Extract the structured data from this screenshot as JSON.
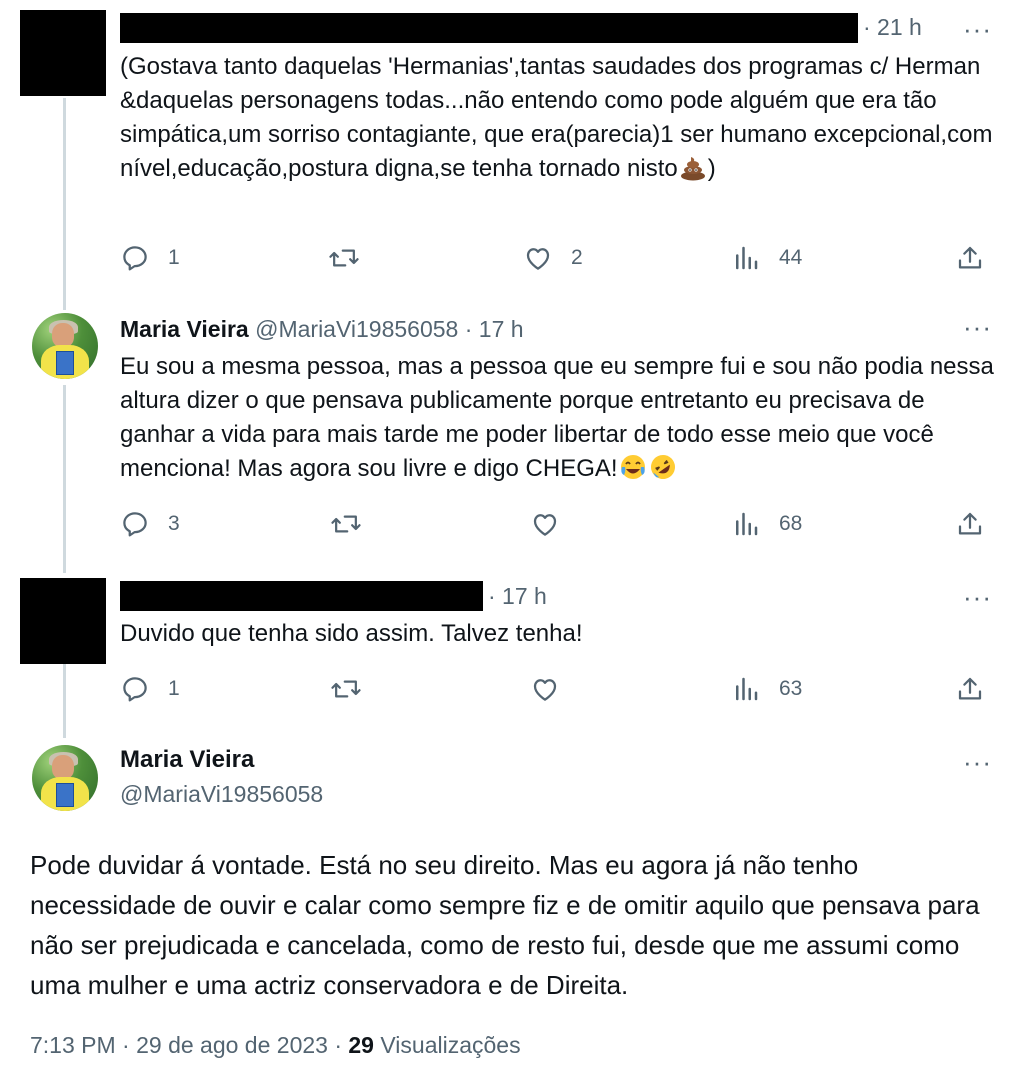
{
  "tweets": [
    {
      "time": "· 21 h",
      "text": "(Gostava tanto daquelas 'Hermanias',tantas saudades dos programas c/ Herman &daquelas personagens todas...não entendo como pode alguém que era tão simpática,um sorriso contagiante, que era(parecia)1 ser humano excepcional,com nível,educação,postura digna,se tenha tornado nisto",
      "text_end": ")",
      "emoji": "pile-of-poo",
      "replies": "1",
      "likes": "2",
      "views": "44"
    },
    {
      "name": "Maria Vieira",
      "handle": "@MariaVi19856058",
      "time": "· 17 h",
      "text": "Eu sou a mesma pessoa, mas a pessoa que eu sempre fui e sou não podia nessa altura dizer o que pensava publicamente porque entretanto eu precisava de ganhar a vida para mais tarde me poder libertar de todo esse meio que você menciona! Mas agora sou livre e digo CHEGA!",
      "emojis": [
        "face-with-tears-of-joy",
        "rolling-on-floor-laughing"
      ],
      "replies": "3",
      "views": "68"
    },
    {
      "time": "· 17 h",
      "text": "Duvido que tenha sido assim. Talvez tenha!",
      "replies": "1",
      "views": "63"
    }
  ],
  "main_tweet": {
    "name": "Maria Vieira",
    "handle": "@MariaVi19856058",
    "text": "Pode duvidar á vontade. Está no seu direito. Mas eu agora já não tenho necessidade de ouvir e calar como sempre fiz e de omitir aquilo que pensava para não ser prejudicada e cancelada, como de resto fui, desde que me assumi como uma mulher e uma actriz conservadora e de Direita.",
    "time": "7:13 PM",
    "date": "· 29 de ago de 2023 ·",
    "views_count": "29",
    "views_label": "Visualizações"
  },
  "icons": {
    "reply": "reply-icon",
    "retweet": "retweet-icon",
    "like": "heart-icon",
    "views": "views-chart-icon",
    "share": "share-icon",
    "more": "more-dots-icon"
  },
  "colors": {
    "text": "#0f1419",
    "muted": "#536471",
    "thread_line": "#cfd9de"
  }
}
